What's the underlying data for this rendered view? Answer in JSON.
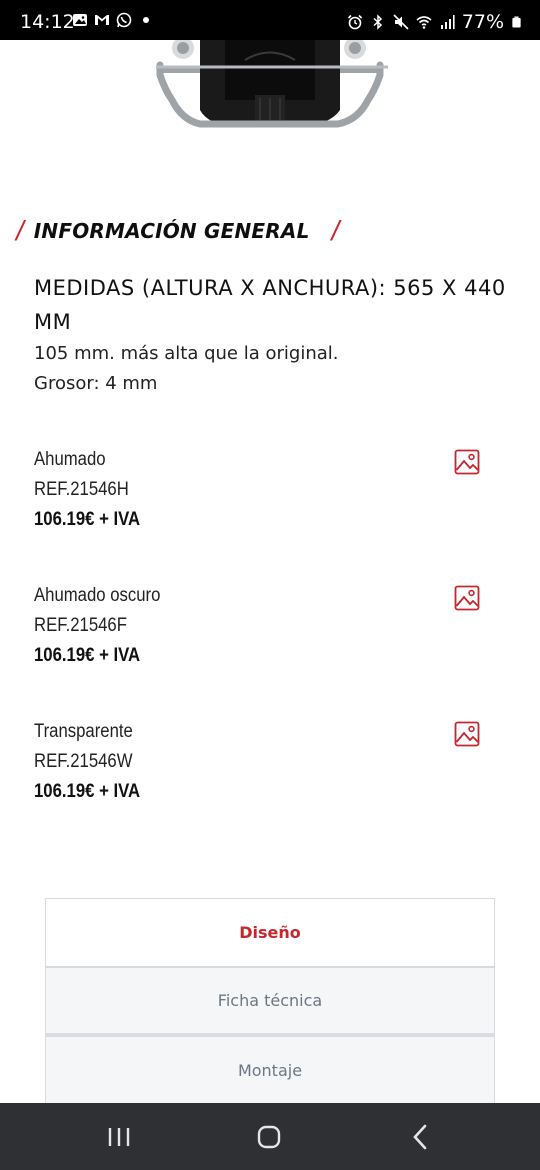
{
  "status_bar": {
    "time": "14:12",
    "battery": "77%",
    "left_icons": [
      "gallery-icon",
      "gmail-icon",
      "whatsapp-icon",
      "dot-icon"
    ],
    "right_icons": [
      "alarm-icon",
      "bluetooth-icon",
      "mute-icon",
      "wifi-icon",
      "signal-icon",
      "battery-icon"
    ]
  },
  "section": {
    "title": "INFORMACIÓN GENERAL",
    "slash": "/"
  },
  "measures": {
    "heading": "MEDIDAS (ALTURA X ANCHURA): 565 X 440 MM",
    "line1": "105 mm. más alta que la original.",
    "line2": "Grosor: 4 mm"
  },
  "variants": [
    {
      "name": "Ahumado",
      "ref": "REF.21546H",
      "price": "106.19€ + IVA"
    },
    {
      "name": "Ahumado oscuro",
      "ref": "REF.21546F",
      "price": "106.19€ + IVA"
    },
    {
      "name": "Transparente",
      "ref": "REF.21546W",
      "price": "106.19€ + IVA"
    }
  ],
  "tabs": [
    {
      "label": "Diseño",
      "active": true
    },
    {
      "label": "Ficha técnica",
      "active": false
    },
    {
      "label": "Montaje",
      "active": false
    }
  ],
  "colors": {
    "accent": "#c6262c",
    "navbar": "#2f3033"
  }
}
